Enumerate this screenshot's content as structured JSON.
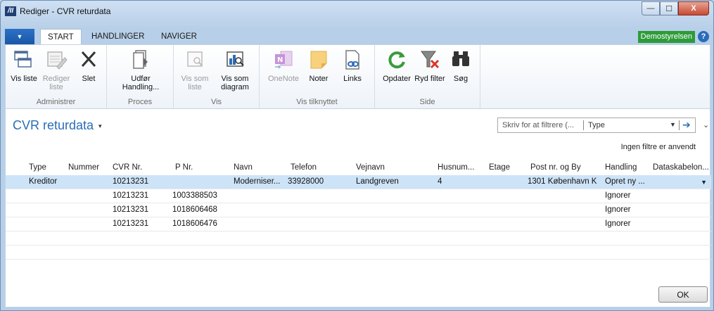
{
  "window": {
    "title": "Rediger - CVR returdata",
    "logo_text": "/II",
    "min_glyph": "—",
    "max_glyph": "☐",
    "close_glyph": "X"
  },
  "tabs": {
    "file_glyph": "▼",
    "items": [
      "START",
      "HANDLINGER",
      "NAVIGER"
    ],
    "company": "Demostyrelsen",
    "help_glyph": "?"
  },
  "ribbon": {
    "groups": [
      {
        "label": "Administrer",
        "buttons": [
          "Vis liste",
          "Rediger liste",
          "Slet"
        ]
      },
      {
        "label": "Proces",
        "buttons": [
          "Udfør Handling..."
        ]
      },
      {
        "label": "Vis",
        "buttons": [
          "Vis som liste",
          "Vis som diagram"
        ]
      },
      {
        "label": "Vis tilknyttet",
        "buttons": [
          "OneNote",
          "Noter",
          "Links"
        ]
      },
      {
        "label": "Side",
        "buttons": [
          "Opdater",
          "Ryd filter",
          "Søg"
        ]
      }
    ]
  },
  "page": {
    "title": "CVR returdata",
    "title_caret": "▾",
    "filter_placeholder": "Skriv for at filtrere (...",
    "filter_field": "Type",
    "dropdown_glyph": "▼",
    "go_glyph": "➔",
    "collapse_glyph": "⌄",
    "filter_status": "Ingen filtre er anvendt"
  },
  "grid": {
    "columns": [
      "Type",
      "Nummer",
      "CVR Nr.",
      "P Nr.",
      "Navn",
      "Telefon",
      "Vejnavn",
      "Husnum...",
      "Etage",
      "Post nr. og By",
      "Handling",
      "Dataskabelon..."
    ],
    "rows": [
      [
        "Kreditor",
        "",
        "10213231",
        "",
        "Moderniser...",
        "33928000",
        "Landgreven",
        "4",
        "",
        "1301 København K",
        "Opret ny ...",
        ""
      ],
      [
        "",
        "",
        "10213231",
        "1003388503",
        "",
        "",
        "",
        "",
        "",
        "",
        "Ignorer",
        ""
      ],
      [
        "",
        "",
        "10213231",
        "1018606468",
        "",
        "",
        "",
        "",
        "",
        "",
        "Ignorer",
        ""
      ],
      [
        "",
        "",
        "10213231",
        "1018606476",
        "",
        "",
        "",
        "",
        "",
        "",
        "Ignorer",
        ""
      ]
    ],
    "row_dropdown_glyph": "▼"
  },
  "footer": {
    "ok_label": "OK"
  },
  "colors": {
    "accent": "#2a6eb8",
    "company_badge": "#2e9b3a",
    "selected_row": "#cde3f7"
  }
}
